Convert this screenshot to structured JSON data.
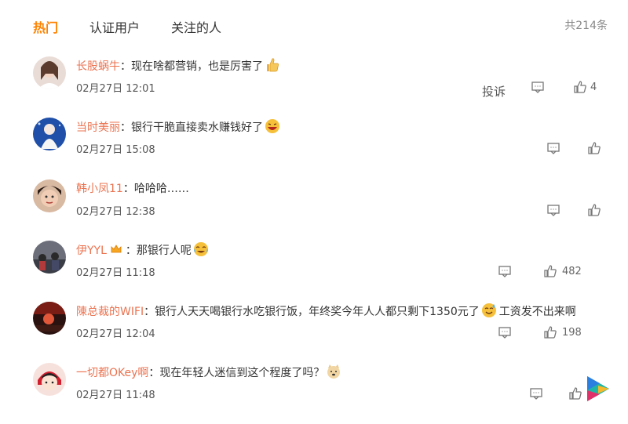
{
  "tabs": {
    "hot": "热门",
    "verified": "认证用户",
    "following": "关注的人"
  },
  "total_count": "共214条",
  "comments": [
    {
      "username": "长股蜗牛",
      "sep": "：",
      "text": "现在啥都营销，也是厉害了",
      "time": "02月27日 12:01",
      "report": "投诉",
      "likes": "4",
      "emoji": "thumbs-up"
    },
    {
      "username": "当时美丽",
      "sep": "：",
      "text": "银行干脆直接卖水赚钱好了",
      "time": "02月27日 15:08",
      "likes": "",
      "emoji": "laughing"
    },
    {
      "username": "韩小凤11",
      "sep": "：",
      "text": "哈哈哈……",
      "time": "02月27日 12:38",
      "likes": ""
    },
    {
      "username": "伊YYL",
      "sep": "：",
      "text": "那银行人呢",
      "time": "02月27日 11:18",
      "likes": "482",
      "emoji": "laugh-cry",
      "badge": "crown"
    },
    {
      "username": "陳总裁的WIFI",
      "sep": "：",
      "text": "银行人天天喝银行水吃银行饭，年终奖今年人人都只剩下1350元了",
      "text2": "工资发不出来啊",
      "time": "02月27日 12:04",
      "likes": "198",
      "emoji": "sweat-smile"
    },
    {
      "username": "一切都OKey啊",
      "sep": "：",
      "text": "现在年轻人迷信到这个程度了吗？",
      "time": "02月27日 11:48",
      "likes": "",
      "emoji": "doge"
    }
  ]
}
